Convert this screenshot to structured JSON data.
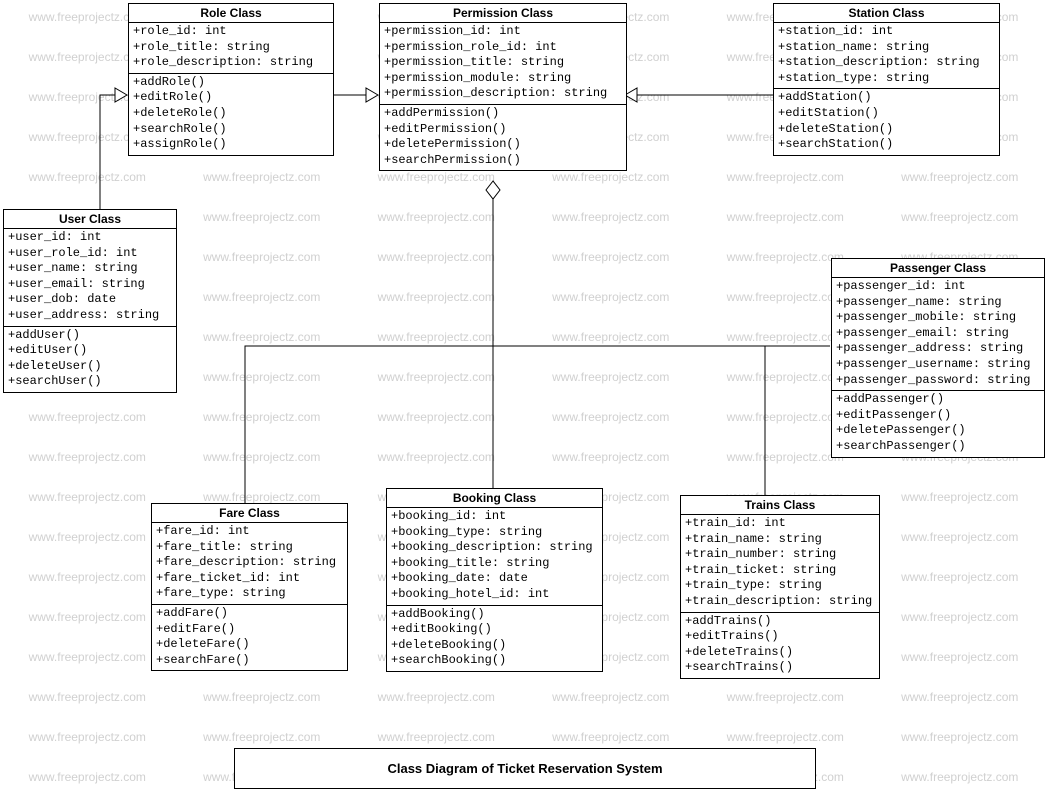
{
  "watermark_text": "www.freeprojectz.com",
  "diagram_title": "Class Diagram of Ticket Reservation System",
  "classes": {
    "role": {
      "title": "Role Class",
      "attrs": [
        "+role_id: int",
        "+role_title: string",
        "+role_description: string"
      ],
      "ops": [
        "+addRole()",
        "+editRole()",
        "+deleteRole()",
        "+searchRole()",
        "+assignRole()"
      ]
    },
    "permission": {
      "title": "Permission Class",
      "attrs": [
        "+permission_id: int",
        "+permission_role_id: int",
        "+permission_title: string",
        "+permission_module: string",
        "+permission_description: string"
      ],
      "ops": [
        "+addPermission()",
        "+editPermission()",
        "+deletePermission()",
        "+searchPermission()"
      ]
    },
    "station": {
      "title": "Station Class",
      "attrs": [
        "+station_id: int",
        "+station_name: string",
        "+station_description: string",
        "+station_type: string"
      ],
      "ops": [
        "+addStation()",
        "+editStation()",
        "+deleteStation()",
        "+searchStation()"
      ]
    },
    "user": {
      "title": "User Class",
      "attrs": [
        "+user_id: int",
        "+user_role_id: int",
        "+user_name: string",
        "+user_email: string",
        "+user_dob: date",
        "+user_address: string"
      ],
      "ops": [
        "+addUser()",
        "+editUser()",
        "+deleteUser()",
        "+searchUser()"
      ]
    },
    "passenger": {
      "title": "Passenger Class",
      "attrs": [
        "+passenger_id: int",
        "+passenger_name: string",
        "+passenger_mobile: string",
        "+passenger_email: string",
        "+passenger_address: string",
        "+passenger_username: string",
        "+passenger_password: string"
      ],
      "ops": [
        "+addPassenger()",
        "+editPassenger()",
        "+deletePassenger()",
        "+searchPassenger()"
      ]
    },
    "fare": {
      "title": "Fare Class",
      "attrs": [
        "+fare_id: int",
        "+fare_title: string",
        "+fare_description: string",
        "+fare_ticket_id: int",
        "+fare_type: string"
      ],
      "ops": [
        "+addFare()",
        "+editFare()",
        "+deleteFare()",
        "+searchFare()"
      ]
    },
    "booking": {
      "title": "Booking Class",
      "attrs": [
        "+booking_id: int",
        "+booking_type: string",
        "+booking_description: string",
        "+booking_title: string",
        "+booking_date: date",
        "+booking_hotel_id: int"
      ],
      "ops": [
        "+addBooking()",
        "+editBooking()",
        "+deleteBooking()",
        "+searchBooking()"
      ]
    },
    "trains": {
      "title": "Trains Class",
      "attrs": [
        "+train_id: int",
        "+train_name: string",
        "+train_number: string",
        "+train_ticket: string",
        "+train_type: string",
        "+train_description: string"
      ],
      "ops": [
        "+addTrains()",
        "+editTrains()",
        "+deleteTrains()",
        "+searchTrains()"
      ]
    }
  }
}
